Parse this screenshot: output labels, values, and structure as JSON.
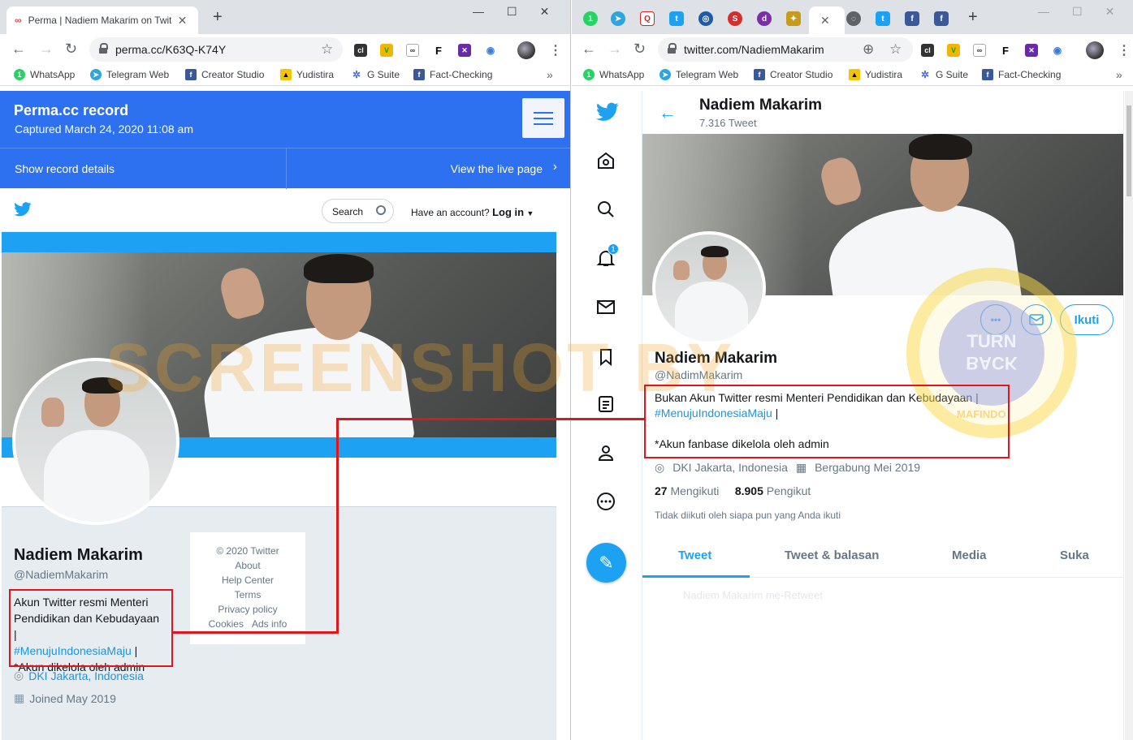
{
  "left": {
    "tab_title": "Perma | Nadiem Makarim on Twit",
    "url": "perma.cc/K63Q-K74Y",
    "bookmarks": [
      "WhatsApp",
      "Telegram Web",
      "Creator Studio",
      "Yudistira",
      "G Suite",
      "Fact-Checking"
    ],
    "perma_title": "Perma.cc record",
    "captured": "Captured March 24, 2020 11:08 am",
    "show_details": "Show record details",
    "view_live": "View the live page",
    "search_placeholder": "Search",
    "have_account": "Have an account?",
    "login": "Log in",
    "name": "Nadiem Makarim",
    "handle": "@NadiemMakarim",
    "bio_1": "Akun Twitter resmi Menteri Pendidikan dan Kebudayaan |",
    "bio_tag": "#MenujuIndonesiaMaju",
    "bio_bar": "|",
    "bio_2": "*Akun dikelola oleh admin",
    "location": "DKI Jakarta, Indonesia",
    "joined": "Joined May 2019",
    "footer": [
      "© 2020 Twitter",
      "About",
      "Help Center",
      "Terms",
      "Privacy policy"
    ],
    "footer_cookies": "Cookies",
    "footer_ads": "Ads info"
  },
  "right": {
    "url": "twitter.com/NadiemMakarim",
    "bookmarks": [
      "WhatsApp",
      "Telegram Web",
      "Creator Studio",
      "Yudistira",
      "G Suite",
      "Fact-Checking"
    ],
    "header_name": "Nadiem Makarim",
    "tweet_count": "7.316 Tweet",
    "follow_label": "Ikuti",
    "name": "Nadiem Makarim",
    "handle": "@NadimMakarim",
    "bio_1": "Bukan Akun Twitter resmi Menteri Pendidikan dan Kebudayaan |",
    "bio_tag": "#MenujuIndonesiaMaju",
    "bio_bar": "|",
    "bio_2": "*Akun fanbase dikelola oleh admin",
    "location": "DKI Jakarta, Indonesia",
    "joined": "Bergabung Mei 2019",
    "following_count": "27",
    "following_label": "Mengikuti",
    "followers_count": "8.905",
    "followers_label": "Pengikut",
    "note": "Tidak diikuti oleh siapa pun yang Anda ikuti",
    "tabs": [
      "Tweet",
      "Tweet & balasan",
      "Media",
      "Suka"
    ],
    "faded_row": "Nadiem Makarim me-Retweet",
    "notif_badge": "1"
  },
  "watermark": {
    "text": "SCREENSHOT BY",
    "seal_top": "TURN",
    "seal_bottom": "BACK",
    "seal_name": "MAFINDO"
  },
  "colors": {
    "perma_blue": "#2d70f0",
    "twitter_blue": "#1da1f2",
    "highlight_red": "#e0161d"
  }
}
